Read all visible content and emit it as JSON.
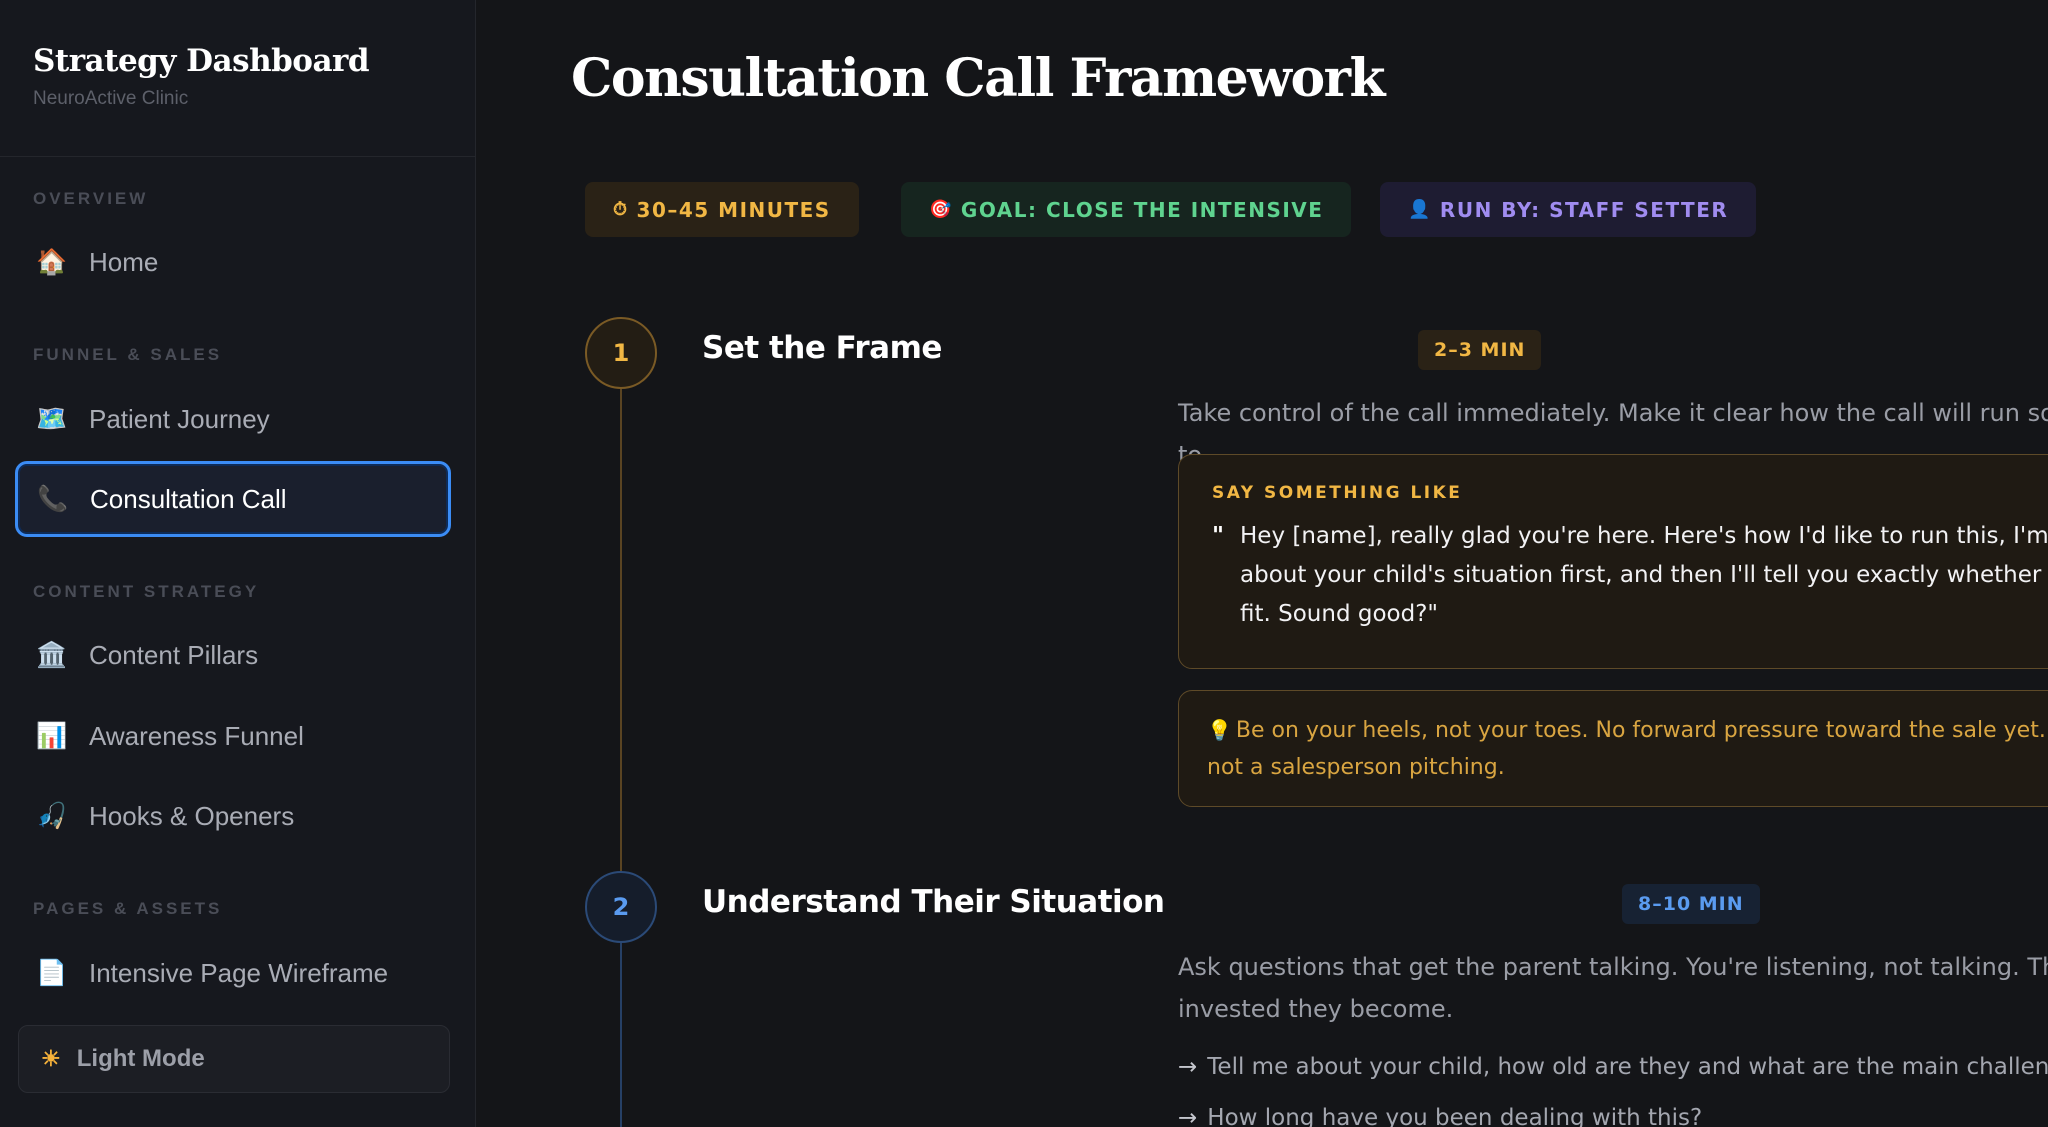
{
  "sidebar": {
    "brand_title": "Strategy Dashboard",
    "brand_subtitle": "NeuroActive Clinic",
    "sections": {
      "overview": "OVERVIEW",
      "funnel": "FUNNEL & SALES",
      "content": "CONTENT STRATEGY",
      "pages": "PAGES & ASSETS"
    },
    "items": {
      "home": {
        "icon": "🏠",
        "label": "Home"
      },
      "patient_journey": {
        "icon": "🗺️",
        "label": "Patient Journey"
      },
      "consultation_call": {
        "icon": "📞",
        "label": "Consultation Call"
      },
      "content_pillars": {
        "icon": "🏛️",
        "label": "Content Pillars"
      },
      "awareness_funnel": {
        "icon": "📊",
        "label": "Awareness Funnel"
      },
      "hooks_openers": {
        "icon": "🎣",
        "label": "Hooks & Openers"
      },
      "intensive_wireframe": {
        "icon": "📄",
        "label": "Intensive Page Wireframe"
      }
    },
    "active_item": "consultation_call",
    "theme_toggle": {
      "icon": "☀",
      "label": "Light Mode"
    }
  },
  "main": {
    "title": "Consultation Call Framework",
    "pills": {
      "time": {
        "icon": "⏱",
        "label": "30–45 MINUTES"
      },
      "goal": {
        "icon": "🎯",
        "label": "GOAL: CLOSE THE INTENSIVE"
      },
      "run": {
        "icon": "👤",
        "label": "RUN BY: STAFF SETTER"
      }
    },
    "steps": [
      {
        "number": "1",
        "title": "Set the Frame",
        "duration": "2–3 MIN",
        "description": "Take control of the call immediately. Make it clear how the call will run so the parent feels guided, not sold to.",
        "script_label": "SAY SOMETHING LIKE",
        "quote_mark": "\"",
        "script": "Hey [name], really glad you're here. Here's how I'd like to run this, I'm going to ask you a few questions about your child's situation first, and then I'll tell you exactly whether we think the intensive is a good fit. Sound good?\"",
        "tip_icon": "💡",
        "tip": "Be on your heels, not your toes. No forward pressure toward the sale yet. You're a doctor taking a history, not a salesperson pitching."
      },
      {
        "number": "2",
        "title": "Understand Their Situation",
        "duration": "8–10 MIN",
        "description": "Ask questions that get the parent talking. You're listening, not talking. The more they talk, the more invested they become.",
        "questions": [
          "Tell me about your child, how old are they and what are the main challenges you're seeing?",
          "How long have you been dealing with this?"
        ],
        "arrow": "→"
      }
    ]
  },
  "colors": {
    "background": "#141518",
    "sidebar": "#16181e",
    "active_border": "#3b8cf5",
    "amber": "#f1b744",
    "green": "#5fd38f",
    "purple": "#a08cf0",
    "blue": "#5a9bf0"
  }
}
